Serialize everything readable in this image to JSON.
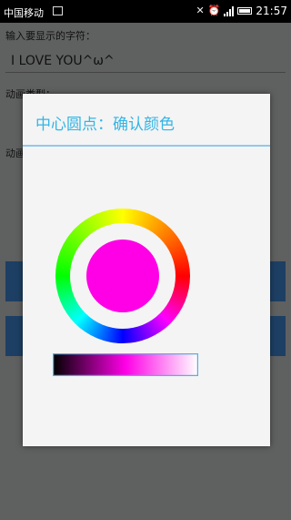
{
  "status_bar": {
    "carrier": "中国移动",
    "time": "21:57"
  },
  "background": {
    "input_label": "输入要显示的字符：",
    "input_value": "I LOVE YOU^ω^",
    "anim_type_label": "动画类型：",
    "anim_label_2": "动画"
  },
  "dialog": {
    "title": "中心圆点：确认颜色",
    "accent_color": "#33b5e5",
    "selected_color": "#ff00e6"
  }
}
